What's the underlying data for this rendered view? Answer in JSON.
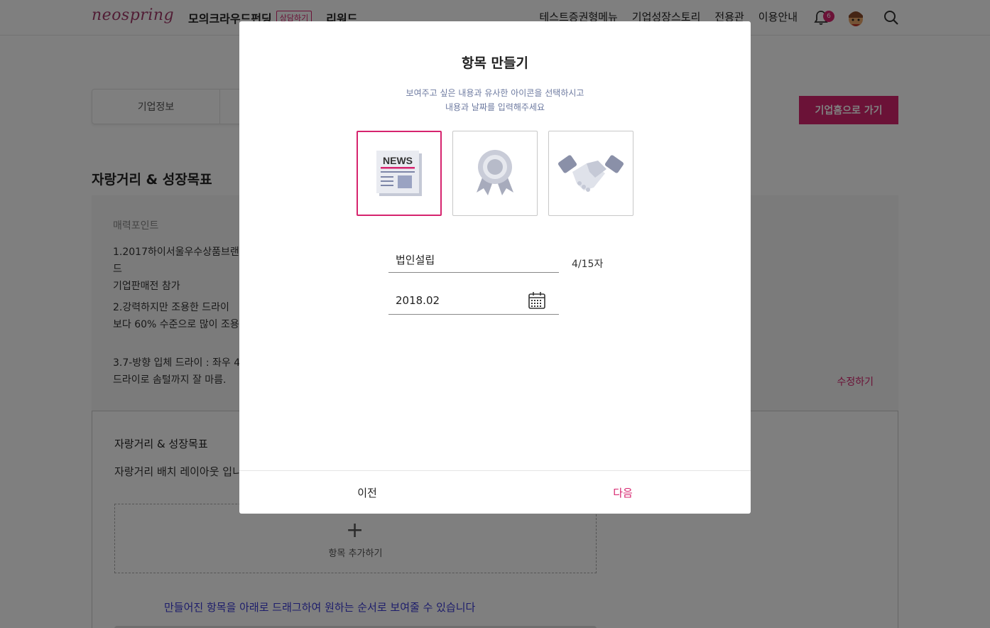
{
  "header": {
    "logo": "neospring",
    "nav_left": [
      {
        "label": "모의크라우드펀딩"
      },
      {
        "label": "상담하기"
      },
      {
        "label": "리워드"
      }
    ],
    "nav_right": [
      {
        "label": "테스트증권형메뉴"
      },
      {
        "label": "기업성장스토리"
      },
      {
        "label": "전용관"
      },
      {
        "label": "이용안내"
      }
    ],
    "notification_count": "6"
  },
  "page": {
    "tabs": [
      {
        "label": "기업정보"
      },
      {
        "label": ""
      }
    ],
    "home_button": "기업홈으로 가기",
    "section_title": "자랑거리 & 성장목표",
    "charm": {
      "label": "매력포인트",
      "items": [
        "1.2017하이서울우수상품브랜드\n기업판매전 참가",
        "2.강력하지만 조용한 드라이\n보다 60% 수준으로 많이 조용",
        "3.7-방향 입체 드라이 : 좌우 4\n드라이로 솜털까지 잘 마름."
      ],
      "edit_link": "수정하기"
    },
    "layout_box": {
      "title": "자랑거리 & 성장목표",
      "desc": "자랑거리 배치 레이아웃 입니",
      "add_label": "항목 추가하기",
      "drag_hint": "만들어진 항목을 아래로 드래그하여 원하는 순서로 보여줄 수 있습니다"
    }
  },
  "modal": {
    "title": "항목 만들기",
    "subtitle_line1": "보여주고 싶은 내용과 유사한 아이콘을 선택하시고",
    "subtitle_line2": "내용과 날짜를 입력해주세요",
    "icons": [
      {
        "name": "news-icon",
        "text": "NEWS",
        "selected": true
      },
      {
        "name": "award-icon",
        "selected": false
      },
      {
        "name": "handshake-icon",
        "selected": false
      }
    ],
    "name_value": "법인설립",
    "name_counter": "4/15자",
    "date_value": "2018.02",
    "prev_label": "이전",
    "next_label": "다음"
  },
  "colors": {
    "accent": "#d6246e",
    "icon_gray": "#9aa0b4",
    "subtitle": "#6d7aa0"
  }
}
